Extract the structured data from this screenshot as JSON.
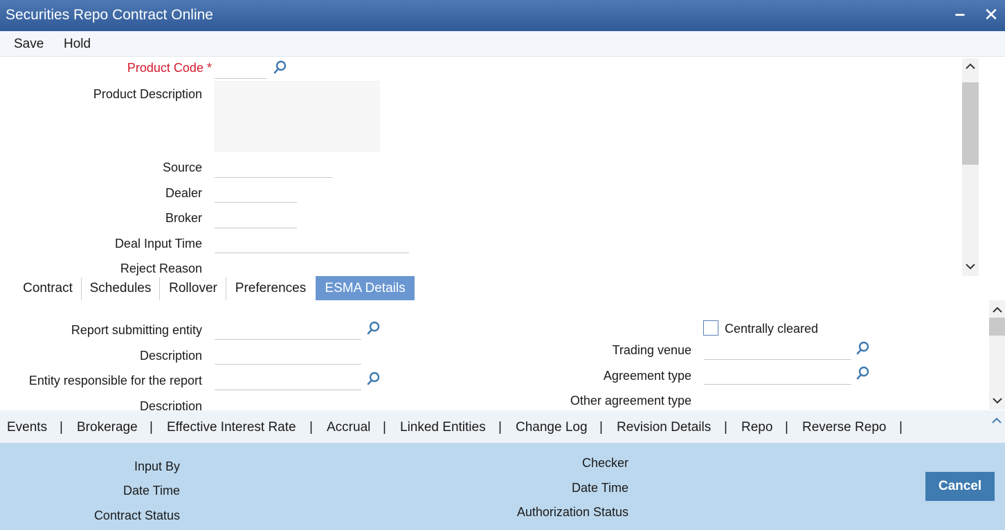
{
  "window": {
    "title": "Securities Repo Contract Online",
    "minimize_glyph": "−",
    "close_glyph": "✕"
  },
  "menu": {
    "save": "Save",
    "hold": "Hold"
  },
  "header": {
    "product_code": {
      "label": "Product Code",
      "required_mark": "*",
      "value": ""
    },
    "product_description": {
      "label": "Product Description",
      "value": ""
    },
    "source": {
      "label": "Source",
      "value": ""
    },
    "dealer": {
      "label": "Dealer",
      "value": ""
    },
    "broker": {
      "label": "Broker",
      "value": ""
    },
    "deal_input_time": {
      "label": "Deal Input Time",
      "value": ""
    },
    "reject_reason": {
      "label": "Reject Reason",
      "value": ""
    }
  },
  "tabs": [
    {
      "label": "Contract"
    },
    {
      "label": "Schedules"
    },
    {
      "label": "Rollover"
    },
    {
      "label": "Preferences"
    },
    {
      "label": "ESMA Details",
      "active": true
    }
  ],
  "esma": {
    "report_submitting_entity": {
      "label": "Report submitting entity",
      "value": ""
    },
    "description_1": {
      "label": "Description",
      "value": ""
    },
    "entity_responsible": {
      "label": "Entity responsible for the report",
      "value": ""
    },
    "description_2": {
      "label": "Description",
      "value": ""
    },
    "centrally_cleared": {
      "label": "Centrally cleared",
      "checked": false
    },
    "trading_venue": {
      "label": "Trading venue",
      "value": ""
    },
    "agreement_type": {
      "label": "Agreement type",
      "value": ""
    },
    "other_agreement_type": {
      "label": "Other agreement type",
      "value": ""
    }
  },
  "links": {
    "items": [
      "Events",
      "Brokerage",
      "Effective Interest Rate",
      "Accrual",
      "Linked Entities",
      "Change Log",
      "Revision Details",
      "Repo",
      "Reverse Repo"
    ],
    "separator": "|"
  },
  "audit": {
    "input_by": "Input By",
    "date_time_left": "Date Time",
    "contract_status": "Contract Status",
    "checker": "Checker",
    "date_time_right": "Date Time",
    "authorization_status": "Authorization Status"
  },
  "cancel_label": "Cancel",
  "icons": {
    "lookup": "search-icon",
    "scroll_up": "chevron-up-icon",
    "scroll_down": "chevron-down-icon"
  },
  "colors": {
    "title_bar": "#3a65a3",
    "active_tab": "#6a97d1",
    "required": "#d3192c",
    "footer": "#bcd8ee",
    "cancel": "#3f7bb0"
  }
}
